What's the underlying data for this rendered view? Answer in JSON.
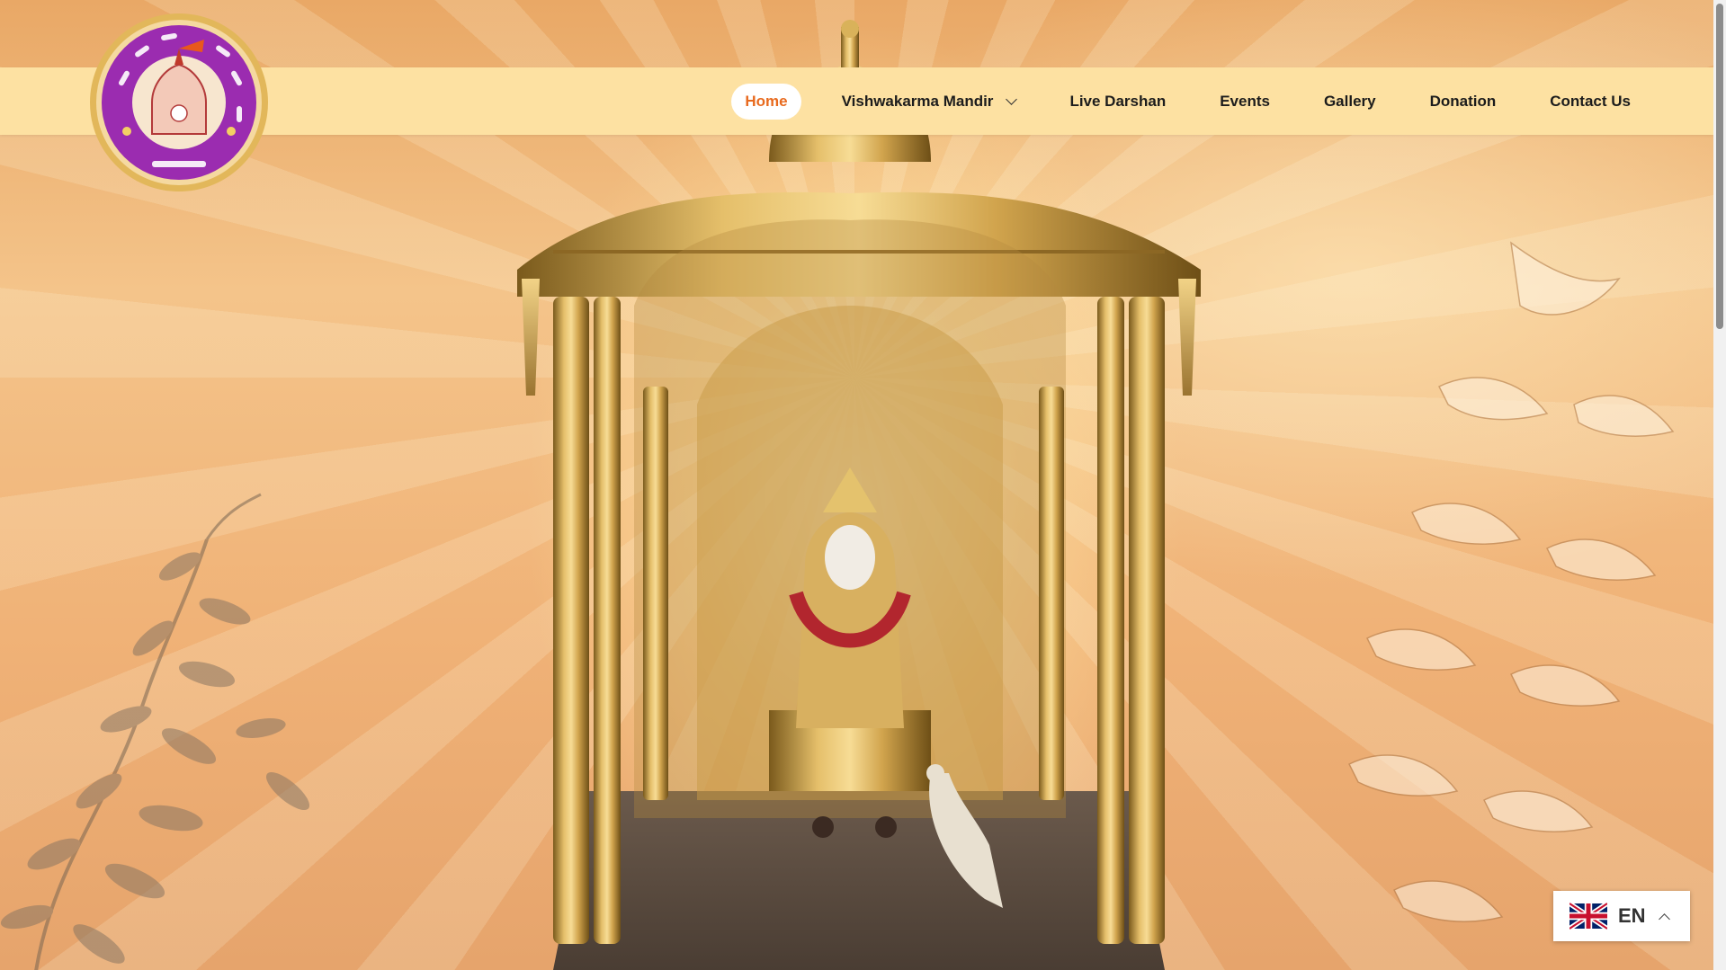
{
  "site": {
    "logo_alt": "Shri Vishwakarma Mandir Trust Dakor logo"
  },
  "nav": {
    "items": [
      {
        "label": "Home",
        "active": true
      },
      {
        "label": "Vishwakarma Mandir",
        "has_dropdown": true
      },
      {
        "label": "Live Darshan"
      },
      {
        "label": "Events"
      },
      {
        "label": "Gallery"
      },
      {
        "label": "Donation"
      },
      {
        "label": "Contact Us"
      }
    ]
  },
  "hero": {
    "image_alt": "Golden temple shrine of Lord Vishwakarma"
  },
  "language": {
    "code": "EN",
    "flag_icon": "uk-flag-icon"
  },
  "colors": {
    "navbar_bg": "#fde1a2",
    "active_text": "#e86a1e",
    "logo_ring": "#9b2cb0",
    "logo_gold": "#d9a43b"
  }
}
